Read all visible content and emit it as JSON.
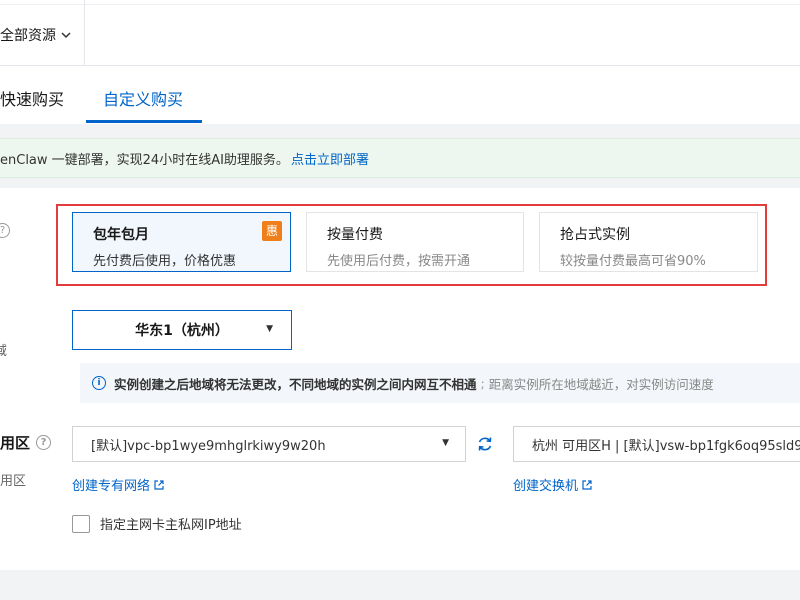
{
  "header": {
    "resource_dropdown": "全部资源"
  },
  "tabs": [
    {
      "label": "快速购买",
      "active": false
    },
    {
      "label": "自定义购买",
      "active": true
    }
  ],
  "notice": {
    "text": "enClaw 一键部署，实现24小时在线AI助理服务。",
    "link": "点击立即部署"
  },
  "billing": {
    "help_icon": "?",
    "options": [
      {
        "title": "包年包月",
        "desc": "先付费后使用，价格优惠",
        "badge": "惠",
        "selected": true
      },
      {
        "title": "按量付费",
        "desc": "先使用后付费，按需开通",
        "selected": false
      },
      {
        "title": "抢占式实例",
        "desc": "较按量付费最高可省90%",
        "selected": false
      }
    ]
  },
  "region": {
    "label_fragment": "域",
    "selected": "华东1（杭州）",
    "tip_strong": "实例创建之后地域将无法更改，不同地域的实例之间内网互不相通",
    "tip_sep": ";",
    "tip_weak": "距离实例所在地域越近，对实例访问速度"
  },
  "network": {
    "label": "用区",
    "sublabel": "用区",
    "help_icon": "?",
    "vpc_value": "[默认]vpc-bp1wye9mhglrkiwy9w20h",
    "vswitch_value": "杭州 可用区H | [默认]vsw-bp1fgk6oq95sld9",
    "create_vpc_link": "创建专有网络",
    "create_vswitch_link": "创建交换机",
    "private_ip_checkbox": "指定主网卡主私网IP地址"
  },
  "colors": {
    "accent": "#0064c8",
    "highlight_outline": "#e23c3c",
    "badge": "#f07f1a",
    "notice_bg": "#edf7ef"
  }
}
